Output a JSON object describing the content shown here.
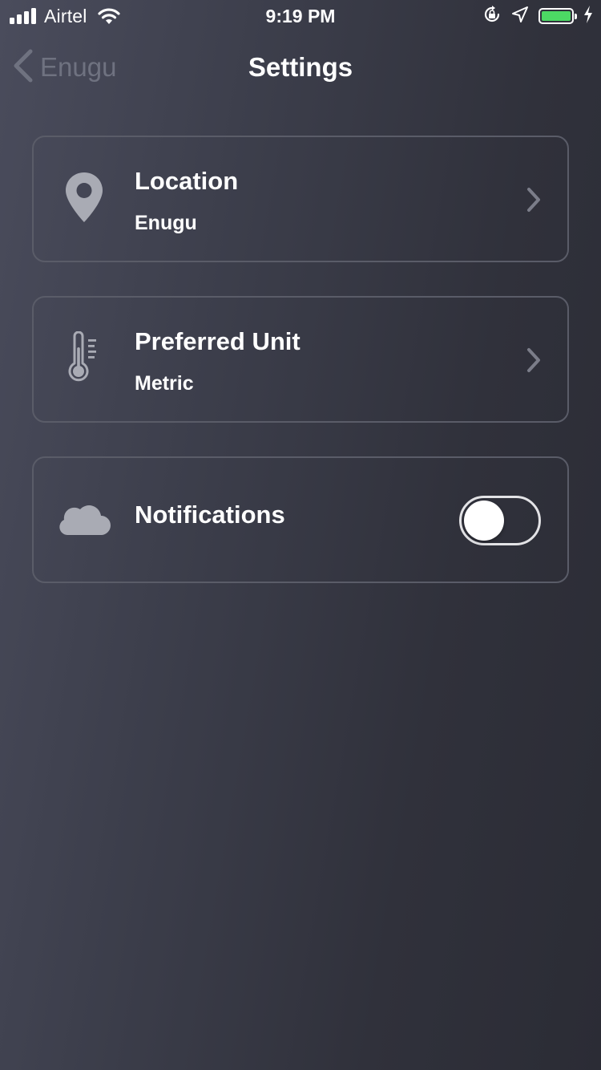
{
  "status_bar": {
    "carrier": "Airtel",
    "time": "9:19 PM",
    "battery_level": 1.0,
    "battery_color": "#4cd964"
  },
  "nav": {
    "back_label": "Enugu",
    "title": "Settings"
  },
  "settings": {
    "location": {
      "title": "Location",
      "value": "Enugu",
      "icon": "map-pin-icon"
    },
    "unit": {
      "title": "Preferred Unit",
      "value": "Metric",
      "icon": "thermometer-icon"
    },
    "notifications": {
      "title": "Notifications",
      "enabled": false,
      "icon": "cloud-icon"
    }
  },
  "colors": {
    "icon_gray": "#a9abb4",
    "chevron_gray": "#7b7d89",
    "card_border": "#5a5c68"
  }
}
